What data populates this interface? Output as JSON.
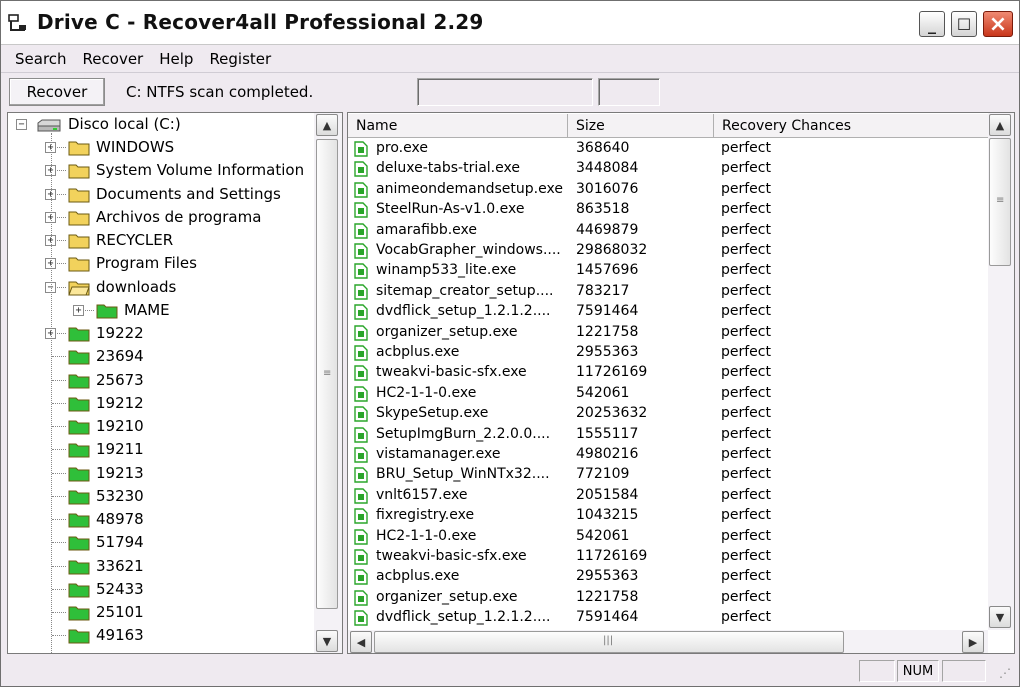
{
  "window": {
    "title": "Drive C  - Recover4all Professional 2.29",
    "minimize_glyph": "_",
    "maximize_glyph": "☐",
    "close_glyph": "×"
  },
  "menu": [
    "Search",
    "Recover",
    "Help",
    "Register"
  ],
  "toolbar": {
    "recover_label": "Recover",
    "status_message": "C: NTFS scan completed."
  },
  "tree": {
    "root_label": "Disco local (C:)",
    "nodes": [
      {
        "label": "WINDOWS",
        "level": 1,
        "expander": "+",
        "icon": "folder-icon"
      },
      {
        "label": "System Volume Information",
        "level": 1,
        "expander": "+",
        "icon": "folder-icon"
      },
      {
        "label": "Documents and Settings",
        "level": 1,
        "expander": "+",
        "icon": "folder-icon"
      },
      {
        "label": "Archivos de programa",
        "level": 1,
        "expander": "+",
        "icon": "folder-icon"
      },
      {
        "label": "RECYCLER",
        "level": 1,
        "expander": "+",
        "icon": "folder-icon"
      },
      {
        "label": "Program Files",
        "level": 1,
        "expander": "+",
        "icon": "folder-icon"
      },
      {
        "label": "downloads",
        "level": 1,
        "expander": "-",
        "icon": "folder-open-icon"
      },
      {
        "label": "MAME",
        "level": 2,
        "expander": "+",
        "icon": "deleted-folder-icon"
      },
      {
        "label": "19222",
        "level": 1,
        "expander": "+",
        "icon": "deleted-folder-icon"
      },
      {
        "label": "23694",
        "level": 1,
        "expander": "",
        "icon": "deleted-folder-icon"
      },
      {
        "label": "25673",
        "level": 1,
        "expander": "",
        "icon": "deleted-folder-icon"
      },
      {
        "label": "19212",
        "level": 1,
        "expander": "",
        "icon": "deleted-folder-icon"
      },
      {
        "label": "19210",
        "level": 1,
        "expander": "",
        "icon": "deleted-folder-icon"
      },
      {
        "label": "19211",
        "level": 1,
        "expander": "",
        "icon": "deleted-folder-icon"
      },
      {
        "label": "19213",
        "level": 1,
        "expander": "",
        "icon": "deleted-folder-icon"
      },
      {
        "label": "53230",
        "level": 1,
        "expander": "",
        "icon": "deleted-folder-icon"
      },
      {
        "label": "48978",
        "level": 1,
        "expander": "",
        "icon": "deleted-folder-icon"
      },
      {
        "label": "51794",
        "level": 1,
        "expander": "",
        "icon": "deleted-folder-icon"
      },
      {
        "label": "33621",
        "level": 1,
        "expander": "",
        "icon": "deleted-folder-icon"
      },
      {
        "label": "52433",
        "level": 1,
        "expander": "",
        "icon": "deleted-folder-icon"
      },
      {
        "label": "25101",
        "level": 1,
        "expander": "",
        "icon": "deleted-folder-icon"
      },
      {
        "label": "49163",
        "level": 1,
        "expander": "",
        "icon": "deleted-folder-icon"
      }
    ]
  },
  "list": {
    "columns": [
      "Name",
      "Size",
      "Recovery Chances"
    ],
    "rows": [
      {
        "name": "pro.exe",
        "size": "368640",
        "chance": "perfect"
      },
      {
        "name": "deluxe-tabs-trial.exe",
        "size": "3448084",
        "chance": "perfect"
      },
      {
        "name": "animeondemandsetup.exe",
        "size": "3016076",
        "chance": "perfect"
      },
      {
        "name": "SteelRun-As-v1.0.exe",
        "size": "863518",
        "chance": "perfect"
      },
      {
        "name": "amarafibb.exe",
        "size": "4469879",
        "chance": "perfect"
      },
      {
        "name": "VocabGrapher_windows....",
        "size": "29868032",
        "chance": "perfect"
      },
      {
        "name": "winamp533_lite.exe",
        "size": "1457696",
        "chance": "perfect"
      },
      {
        "name": "sitemap_creator_setup....",
        "size": "783217",
        "chance": "perfect"
      },
      {
        "name": "dvdflick_setup_1.2.1.2....",
        "size": "7591464",
        "chance": "perfect"
      },
      {
        "name": "organizer_setup.exe",
        "size": "1221758",
        "chance": "perfect"
      },
      {
        "name": "acbplus.exe",
        "size": "2955363",
        "chance": "perfect"
      },
      {
        "name": "tweakvi-basic-sfx.exe",
        "size": "11726169",
        "chance": "perfect"
      },
      {
        "name": "HC2-1-1-0.exe",
        "size": "542061",
        "chance": "perfect"
      },
      {
        "name": "SkypeSetup.exe",
        "size": "20253632",
        "chance": "perfect"
      },
      {
        "name": "SetupImgBurn_2.2.0.0....",
        "size": "1555117",
        "chance": "perfect"
      },
      {
        "name": "vistamanager.exe",
        "size": "4980216",
        "chance": "perfect"
      },
      {
        "name": "BRU_Setup_WinNTx32....",
        "size": "772109",
        "chance": "perfect"
      },
      {
        "name": "vnlt6157.exe",
        "size": "2051584",
        "chance": "perfect"
      },
      {
        "name": "fixregistry.exe",
        "size": "1043215",
        "chance": "perfect"
      },
      {
        "name": "HC2-1-1-0.exe",
        "size": "542061",
        "chance": "perfect"
      },
      {
        "name": "tweakvi-basic-sfx.exe",
        "size": "11726169",
        "chance": "perfect"
      },
      {
        "name": "acbplus.exe",
        "size": "2955363",
        "chance": "perfect"
      },
      {
        "name": "organizer_setup.exe",
        "size": "1221758",
        "chance": "perfect"
      },
      {
        "name": "dvdflick_setup_1.2.1.2....",
        "size": "7591464",
        "chance": "perfect"
      }
    ]
  },
  "statusbar": {
    "pane1": "",
    "pane2": "NUM",
    "pane3": ""
  },
  "colors": {
    "folder_yellow": "#f2d25c",
    "deleted_folder_green": "#2fbf3a",
    "file_icon_green": "#2aa52a",
    "close_red": "#c8361b"
  }
}
